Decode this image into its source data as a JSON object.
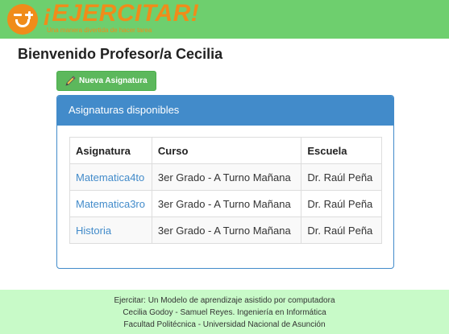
{
  "header": {
    "brand_title": "¡EJERCITAR!",
    "tagline": "Una manera divertida de hacer tarea",
    "logo_icon": "smiley-plus-minus-icon",
    "accent_color": "#f08c1a",
    "bar_color": "#6ecf6e"
  },
  "main": {
    "welcome": "Bienvenido Profesor/a Cecilia",
    "new_subject_button": "Nueva Asignatura",
    "new_subject_icon": "pencil-icon",
    "panel_title": "Asignaturas disponibles",
    "table": {
      "headers": [
        "Asignatura",
        "Curso",
        "Escuela"
      ],
      "rows": [
        [
          "Matematica4to",
          "3er Grado - A Turno Mañana",
          "Dr. Raúl Peña"
        ],
        [
          "Matematica3ro",
          "3er Grado - A Turno Mañana",
          "Dr. Raúl Peña"
        ],
        [
          "Historia",
          "3er Grado - A Turno Mañana",
          "Dr. Raúl Peña"
        ]
      ]
    }
  },
  "footer": {
    "line1": "Ejercitar: Un Modelo de aprendizaje asistido por computadora",
    "line2": "Cecilia Godoy - Samuel Reyes. Ingeniería en Informática",
    "line3": "Facultad Politécnica - Universidad Nacional de Asunción"
  }
}
